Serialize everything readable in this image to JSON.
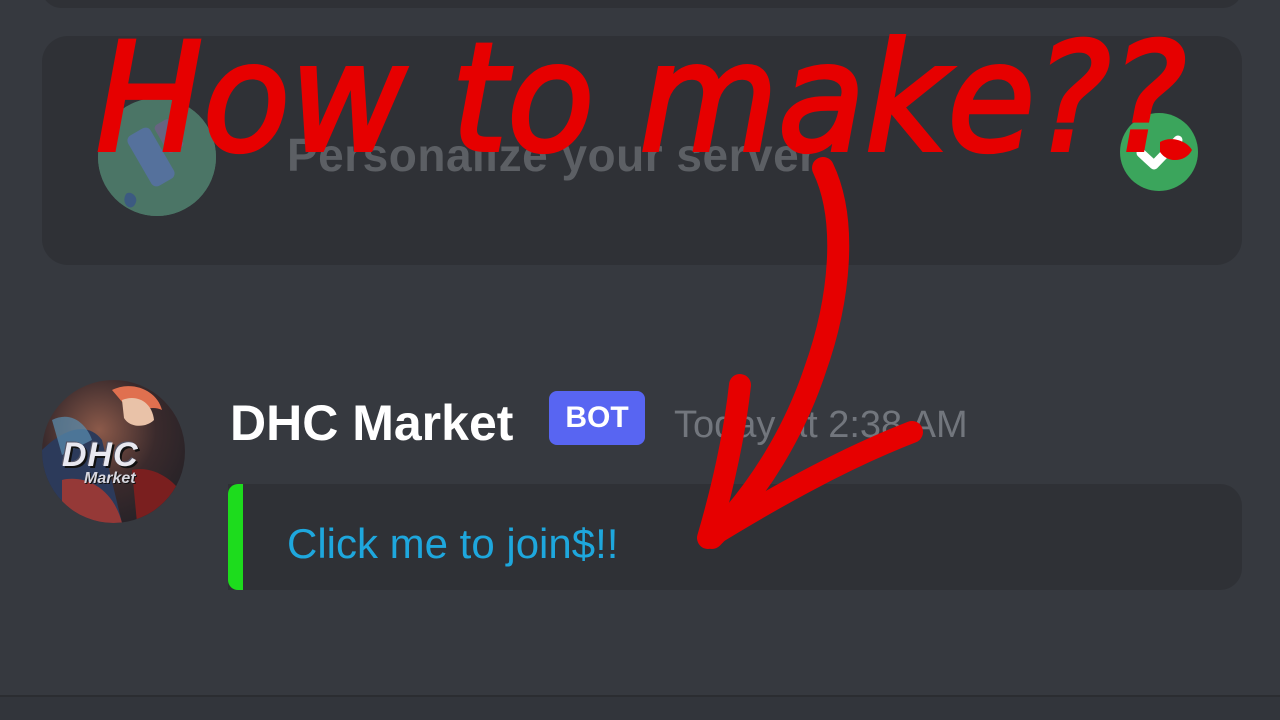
{
  "setup_card": {
    "title": "Personalize your server",
    "status": "completed"
  },
  "message": {
    "author": "DHC Market",
    "tag": "BOT",
    "timestamp": "Today at 2:38 AM",
    "embed": {
      "link_text": "Click me to join$!!",
      "accent_color": "#1ddc1d"
    },
    "avatar": {
      "logo_text": "DHC",
      "logo_subtext": "Market"
    }
  },
  "annotation": {
    "text": "How to make??",
    "color": "#e60000"
  },
  "colors": {
    "background": "#36393f",
    "card": "#2f3136",
    "bot_tag": "#5865f2",
    "link": "#1ea7dd",
    "check": "#3ba55c"
  }
}
